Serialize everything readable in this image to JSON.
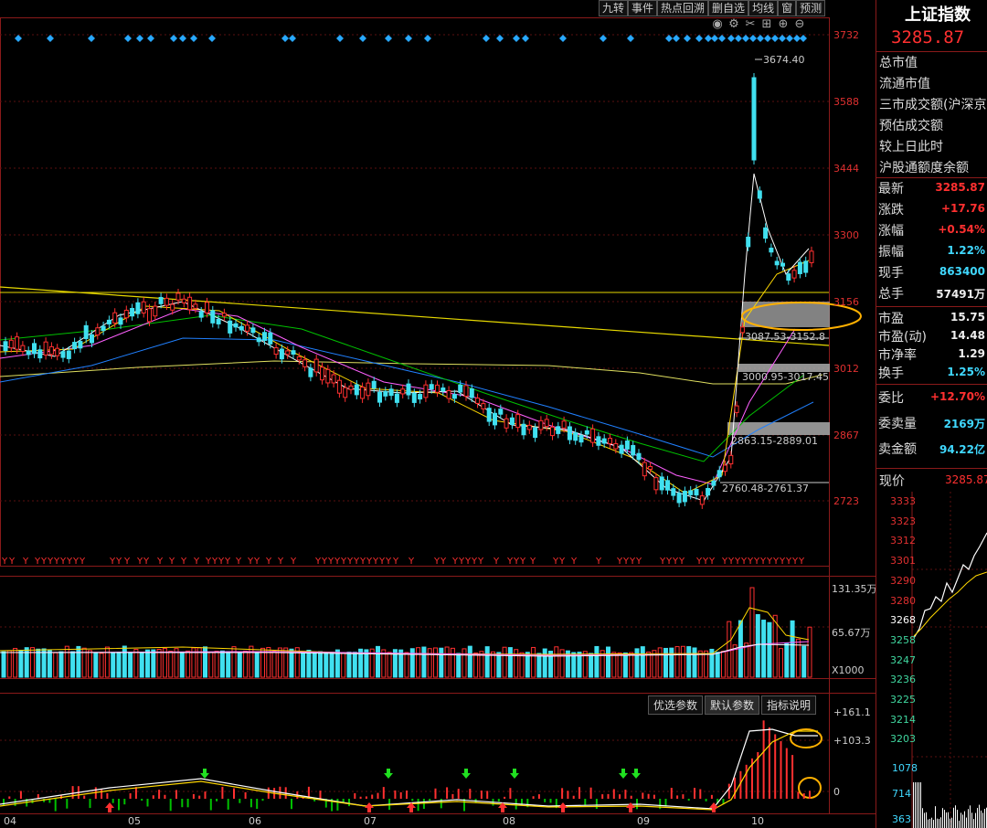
{
  "toolbar": [
    "九转",
    "事件",
    "热点回溯",
    "删自选",
    "均线",
    "窗",
    "预测"
  ],
  "price_axis": [
    "3732",
    "3588",
    "3444",
    "3300",
    "3156",
    "3012",
    "2867",
    "2723"
  ],
  "annotations": {
    "high": "3674.40",
    "gap1": "3087.53-3152.8",
    "gap2": "3000.95-3017.45",
    "gap3": "2863.15-2889.01",
    "low": "2760.48-2761.37"
  },
  "volume_axis": {
    "top": "131.35万",
    "mid": "65.67万",
    "unit": "X1000"
  },
  "indicator_axis": {
    "top": "+161.1",
    "mid": "+103.3",
    "zero": "0"
  },
  "indicator_tabs": {
    "t1": "优选参数",
    "t2": "默认参数",
    "t3": "指标说明"
  },
  "months": {
    "m04": "04",
    "m05": "05",
    "m06": "06",
    "m07": "07",
    "m08": "08",
    "m09": "09",
    "m10": "10"
  },
  "panel": {
    "title": "上证指数",
    "price": "3285.87",
    "info": {
      "r1": "总市值",
      "r2": "流通市值",
      "r3": "三市成交额(沪深京",
      "r4": "预估成交额",
      "r5": "较上日此时",
      "r6": "沪股通额度余额"
    },
    "stats": [
      {
        "label": "最新",
        "value": "3285.87",
        "color": "red"
      },
      {
        "label": "涨跌",
        "value": "+17.76",
        "color": "red"
      },
      {
        "label": "涨幅",
        "value": "+0.54%",
        "color": "red"
      },
      {
        "label": "振幅",
        "value": "1.22%",
        "color": "cyan"
      },
      {
        "label": "现手",
        "value": "863400",
        "color": "cyan"
      },
      {
        "label": "总手",
        "value": "57491万",
        "color": "white"
      }
    ],
    "stats2": [
      {
        "label": "市盈",
        "value": "15.75",
        "color": "white"
      },
      {
        "label": "市盈(动)",
        "value": "14.48",
        "color": "white"
      },
      {
        "label": "市净率",
        "value": "1.29",
        "color": "white"
      },
      {
        "label": "换手",
        "value": "1.25%",
        "color": "cyan"
      }
    ],
    "stats3": [
      {
        "label": "委比",
        "value": "+12.70%",
        "color": "red"
      },
      {
        "label": "委卖量",
        "value": "2169万",
        "color": "cyan"
      },
      {
        "label": "卖金额",
        "value": "94.22亿",
        "color": "cyan"
      }
    ],
    "now_label": "现价",
    "now_value": "3285.87",
    "mini_axis": [
      "3333",
      "3323",
      "3312",
      "3301",
      "3290",
      "3280",
      "3268",
      "3258",
      "3247",
      "3236",
      "3225",
      "3214",
      "3203"
    ],
    "mini_vol_axis": [
      "1078",
      "714",
      "363"
    ]
  },
  "colors": {
    "up": "#ff3030",
    "down": "#40e0f0",
    "ma5": "#ffffff",
    "ma10": "#ffd800",
    "ma20": "#ff60ff",
    "ma60": "#00d000",
    "ma120": "#2080ff",
    "ma250": "#e0e060"
  }
}
